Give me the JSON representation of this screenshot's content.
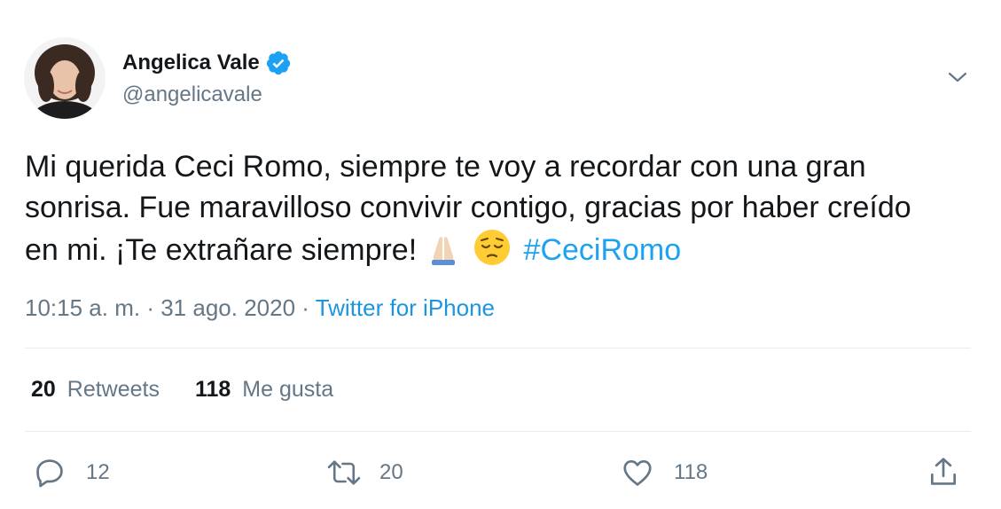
{
  "author": {
    "name": "Angelica Vale",
    "handle": "@angelicavale"
  },
  "tweet": {
    "text_line1": "Mi querida Ceci Romo, siempre te voy a recordar con una gran",
    "text_line2": "sonrisa. Fue maravilloso convivir contigo, gracias por haber creído",
    "text_line3_prefix": "en mi. ¡Te extrañare siempre!",
    "emojis": [
      "folded-hands-light-skin",
      "pensive-face"
    ],
    "hashtag": "#CeciRomo"
  },
  "meta": {
    "time": "10:15 a. m.",
    "separator": "·",
    "date": "31 ago. 2020",
    "source": "Twitter for iPhone"
  },
  "stats": {
    "retweets_count": "20",
    "retweets_label": "Retweets",
    "likes_count": "118",
    "likes_label": "Me gusta"
  },
  "actions": {
    "reply_count": "12",
    "retweet_count": "20",
    "like_count": "118"
  },
  "colors": {
    "link": "#1da1f2",
    "secondary_text": "#657786",
    "verified": "#1da1f2",
    "divider": "#e6ecf0"
  }
}
